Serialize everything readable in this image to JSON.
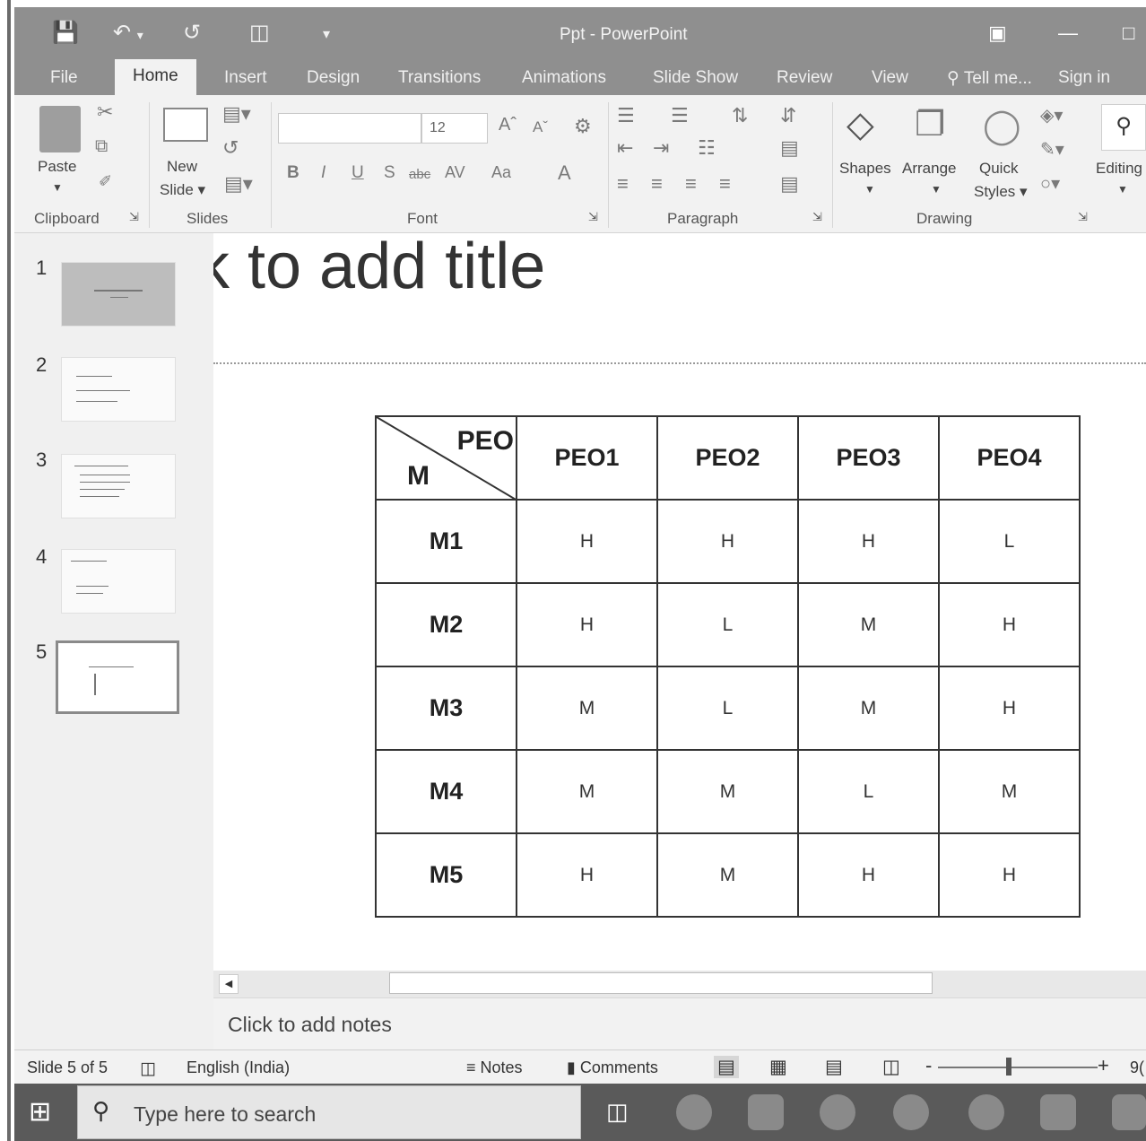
{
  "window": {
    "title": "Ppt - PowerPoint"
  },
  "quick_access": {
    "save_icon": "save-icon",
    "undo_icon": "undo-icon",
    "redo_icon": "redo-icon",
    "present_icon": "start-from-beginning-icon",
    "customize_icon": "customize-qat-icon"
  },
  "tabs": [
    {
      "label": "File"
    },
    {
      "label": "Home",
      "active": true
    },
    {
      "label": "Insert"
    },
    {
      "label": "Design"
    },
    {
      "label": "Transitions"
    },
    {
      "label": "Animations"
    },
    {
      "label": "Slide Show"
    },
    {
      "label": "Review"
    },
    {
      "label": "View"
    },
    {
      "label": "Tell me..."
    }
  ],
  "sign_in": "Sign in",
  "ribbon": {
    "paste_label": "Paste",
    "new_slide_label_1": "New",
    "new_slide_label_2": "Slide",
    "font_size": "12",
    "shapes_label": "Shapes",
    "arrange_label": "Arrange",
    "quick_styles_label_1": "Quick",
    "quick_styles_label_2": "Styles",
    "editing_label": "Editing",
    "groups": {
      "clipboard": "Clipboard",
      "slides": "Slides",
      "font": "Font",
      "paragraph": "Paragraph",
      "drawing": "Drawing"
    },
    "font_buttons": {
      "bold": "B",
      "italic": "I",
      "underline": "U",
      "shadow": "S",
      "strike": "abc",
      "spacing": "AV",
      "case": "Aa",
      "color": "A"
    }
  },
  "thumbnails": [
    {
      "number": "1"
    },
    {
      "number": "2"
    },
    {
      "number": "3"
    },
    {
      "number": "4"
    },
    {
      "number": "5"
    }
  ],
  "slide": {
    "title_text": "k to add title",
    "table": {
      "corner_top": "PEO",
      "corner_bottom": "M",
      "headers": [
        "PEO1",
        "PEO2",
        "PEO3",
        "PEO4"
      ],
      "rows": [
        {
          "label": "M1",
          "values": [
            "H",
            "H",
            "H",
            "L"
          ]
        },
        {
          "label": "M2",
          "values": [
            "H",
            "L",
            "M",
            "H"
          ]
        },
        {
          "label": "M3",
          "values": [
            "M",
            "L",
            "M",
            "H"
          ]
        },
        {
          "label": "M4",
          "values": [
            "M",
            "M",
            "L",
            "M"
          ]
        },
        {
          "label": "M5",
          "values": [
            "H",
            "M",
            "H",
            "H"
          ]
        }
      ]
    }
  },
  "notes": {
    "placeholder": "Click to add notes"
  },
  "status": {
    "slide_indicator": "Slide 5 of 5",
    "language": "English (India)",
    "notes_label": "Notes",
    "comments_label": "Comments",
    "zoom_text": "9("
  },
  "taskbar": {
    "search_placeholder": "Type here to search"
  }
}
